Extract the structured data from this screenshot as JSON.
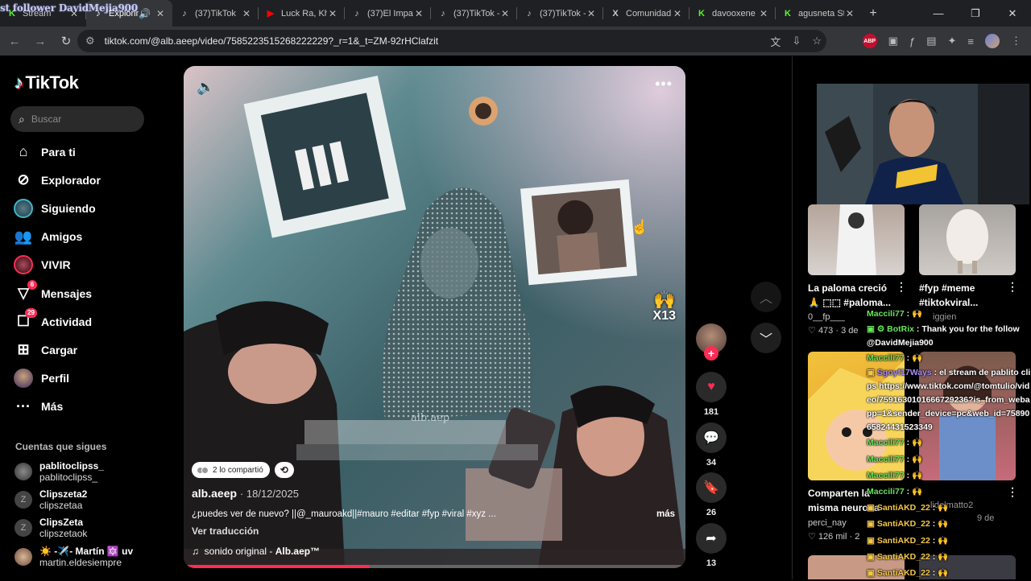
{
  "browser": {
    "overlay_text": "st follower DavidMejia900",
    "tabs": [
      {
        "label": "Stream",
        "icon": "K"
      },
      {
        "label": "Explorin",
        "icon": "♪",
        "active": true
      },
      {
        "label": "(37)TikTok",
        "icon": "♪"
      },
      {
        "label": "Luck Ra, Kh",
        "icon": "▶"
      },
      {
        "label": "(37)El Impa",
        "icon": "♪"
      },
      {
        "label": "(37)TikTok -",
        "icon": "♪"
      },
      {
        "label": "(37)TikTok -",
        "icon": "♪"
      },
      {
        "label": "Comunidad",
        "icon": "X"
      },
      {
        "label": "davooxene",
        "icon": "K"
      },
      {
        "label": "agusneta St",
        "icon": "K"
      }
    ],
    "url": "tiktok.com/@alb.aeep/video/7585223515268222229?_r=1&_t=ZM-92rHClafzit"
  },
  "sidebar": {
    "brand": "TikTok",
    "search_placeholder": "Buscar",
    "nav": [
      {
        "label": "Para ti",
        "icon": "home-icon"
      },
      {
        "label": "Explorador",
        "icon": "compass-icon"
      },
      {
        "label": "Siguiendo",
        "icon": "following-icon"
      },
      {
        "label": "Amigos",
        "icon": "friends-icon"
      },
      {
        "label": "VIVIR",
        "icon": "live-icon"
      },
      {
        "label": "Mensajes",
        "icon": "messages-icon",
        "badge": "6"
      },
      {
        "label": "Actividad",
        "icon": "activity-icon",
        "badge": "29"
      },
      {
        "label": "Cargar",
        "icon": "upload-icon"
      },
      {
        "label": "Perfil",
        "icon": "profile-icon"
      },
      {
        "label": "Más",
        "icon": "more-icon"
      }
    ],
    "following_title": "Cuentas que sigues",
    "accounts": [
      {
        "name": "pablitoclipss_",
        "handle": "pablitoclipss_"
      },
      {
        "name": "Clipszeta2",
        "handle": "clipszetaa"
      },
      {
        "name": "ClipsZeta",
        "handle": "clipszetaok"
      },
      {
        "name": "☀️ -✈️- Martín 🔯 uv",
        "handle": "martin.eldesiempre"
      }
    ]
  },
  "video": {
    "shared_label": "2 lo compartió",
    "author": "alb.aeep",
    "date": "18/12/2025",
    "caption": "¿puedes ver de nuevo? ||@_mauroakd||#mauro #editar #fyp #viral #xyz ...",
    "more_label": "más",
    "translate_label": "Ver traducción",
    "sound_prefix": "sonido original - ",
    "sound_name": "Alb.aep™",
    "watermark": "alb.aep",
    "multiplier": "X13",
    "progress_fraction": 0.37
  },
  "actions": {
    "likes": "181",
    "comments": "34",
    "saves": "26",
    "shares": "13"
  },
  "feed": [
    {
      "title": "La paloma creció",
      "title2": "🙏 ⬚⬚ #paloma...",
      "user": "0__fp___",
      "likes": "473",
      "age": "3 de"
    },
    {
      "title": "#fyp #meme",
      "title2": "#tiktokviral...",
      "user": "iggien",
      "likes": "",
      "age": ""
    },
    {
      "title": "Comparten la",
      "title2": "misma neurona",
      "user": "perci_nay",
      "likes": "126 mil",
      "age": "2"
    },
    {
      "title": "",
      "title2": "",
      "user": "lidelmatto2",
      "likes": "",
      "age": "9 de"
    }
  ],
  "chat": [
    {
      "user": "Maccili77",
      "msg": "🙌",
      "cls": "u1"
    },
    {
      "user": "BotRix",
      "msg": "Thank you for the follow @DavidMejia900",
      "cls": "u2"
    },
    {
      "user": "Maccili77",
      "msg": "🙌",
      "cls": "u1"
    },
    {
      "user": "Sgoyf17Ways",
      "msg": "el stream de pablito clips https://www.tiktok.com/@tomtulio/video/7591630101666729236?is_from_webapp=1&sender_device=pc&web_id=7589065824431523349",
      "cls": "u3"
    },
    {
      "user": "Maccili77",
      "msg": "🙌",
      "cls": "u1"
    },
    {
      "user": "Maccili77",
      "msg": "🙌",
      "cls": "u1"
    },
    {
      "user": "Maccili77",
      "msg": "🙌",
      "cls": "u1"
    },
    {
      "user": "Maccili77",
      "msg": "🙌",
      "cls": "u1"
    },
    {
      "user": "SantiAKD_22",
      "msg": "🙌",
      "cls": "u4"
    },
    {
      "user": "SantiAKD_22",
      "msg": "🙌",
      "cls": "u4"
    },
    {
      "user": "SantiAKD_22",
      "msg": "🙌",
      "cls": "u4"
    },
    {
      "user": "SantiAKD_22",
      "msg": "🙌",
      "cls": "u4"
    },
    {
      "user": "SantiAKD_22",
      "msg": "🙌",
      "cls": "u4"
    }
  ],
  "colors": {
    "accent": "#fe2c55",
    "chrome_bg": "#1f2023",
    "toolbar_bg": "#35363a"
  }
}
